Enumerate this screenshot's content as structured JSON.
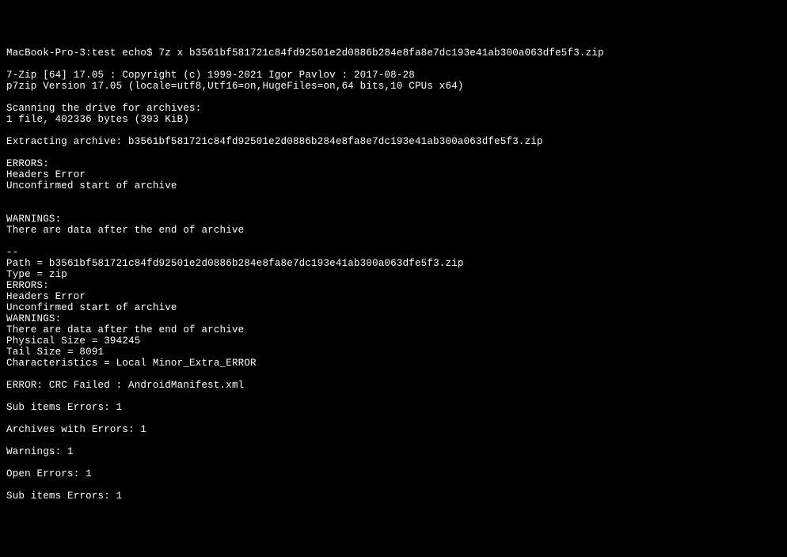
{
  "terminal": {
    "prompt": "MacBook-Pro-3:test echo$ ",
    "command": "7z x b3561bf581721c84fd92501e2d0886b284e8fa8e7dc193e41ab300a063dfe5f3.zip",
    "lines": {
      "l0": "",
      "l1": "7-Zip [64] 17.05 : Copyright (c) 1999-2021 Igor Pavlov : 2017-08-28",
      "l2": "p7zip Version 17.05 (locale=utf8,Utf16=on,HugeFiles=on,64 bits,10 CPUs x64)",
      "l3": "",
      "l4": "Scanning the drive for archives:",
      "l5": "1 file, 402336 bytes (393 KiB)",
      "l6": "",
      "l7": "Extracting archive: b3561bf581721c84fd92501e2d0886b284e8fa8e7dc193e41ab300a063dfe5f3.zip",
      "l8": "",
      "l9": "ERRORS:",
      "l10": "Headers Error",
      "l11": "Unconfirmed start of archive",
      "l12": "",
      "l13": "",
      "l14": "WARNINGS:",
      "l15": "There are data after the end of archive",
      "l16": "",
      "l17": "--",
      "l18": "Path = b3561bf581721c84fd92501e2d0886b284e8fa8e7dc193e41ab300a063dfe5f3.zip",
      "l19": "Type = zip",
      "l20": "ERRORS:",
      "l21": "Headers Error",
      "l22": "Unconfirmed start of archive",
      "l23": "WARNINGS:",
      "l24": "There are data after the end of archive",
      "l25": "Physical Size = 394245",
      "l26": "Tail Size = 8091",
      "l27": "Characteristics = Local Minor_Extra_ERROR",
      "l28": "",
      "l29": "ERROR: CRC Failed : AndroidManifest.xml",
      "l30": "",
      "l31": "Sub items Errors: 1",
      "l32": "",
      "l33": "Archives with Errors: 1",
      "l34": "",
      "l35": "Warnings: 1",
      "l36": "",
      "l37": "Open Errors: 1",
      "l38": "",
      "l39": "Sub items Errors: 1"
    }
  }
}
